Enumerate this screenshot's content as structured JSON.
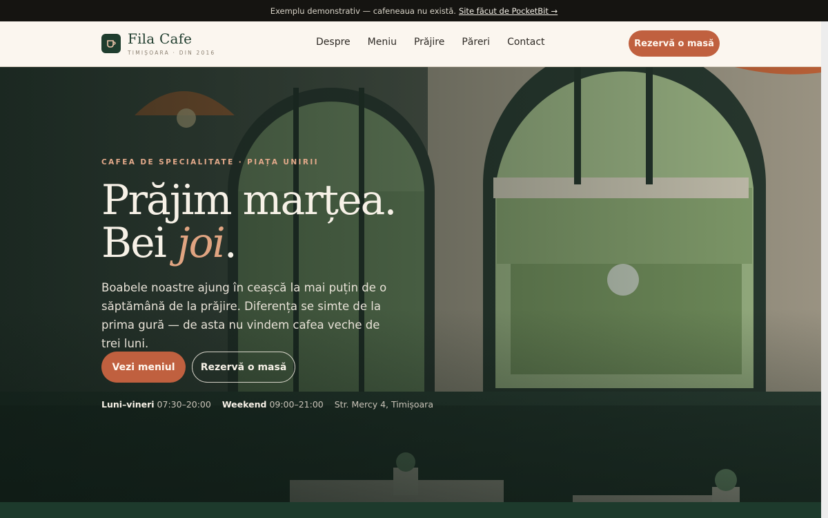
{
  "banner": {
    "text": "Exemplu demonstrativ — cafeneaua nu există.",
    "link": "Site făcut de PocketBit →"
  },
  "brand": {
    "name": "Fila Cafe",
    "subtitle": "TIMIȘOARA · DIN 2016",
    "icon": "cup-icon"
  },
  "nav": {
    "items": [
      "Despre",
      "Meniu",
      "Prăjire",
      "Păreri",
      "Contact"
    ],
    "cta": "Rezervă o masă"
  },
  "hero": {
    "eyebrow": "CAFEA DE SPECIALITATE · PIAȚA UNIRII",
    "headline_line1": "Prăjim marțea.",
    "headline_line2_prefix": "Bei ",
    "headline_line2_accent": "joi",
    "headline_line2_suffix": ".",
    "lead": "Boabele noastre ajung în ceașcă la mai puțin de o săptămână de la prăjire. Diferența se simte de la prima gură — de asta nu vindem cafea veche de trei luni.",
    "primary_button": "Vezi meniul",
    "secondary_button": "Rezervă o masă",
    "hours": [
      {
        "label": "Luni–vineri",
        "value": "07:30–20:00"
      },
      {
        "label": "Weekend",
        "value": "09:00–21:00"
      }
    ],
    "address": "Str. Mercy 4, Timișoara"
  },
  "colors": {
    "accent": "#c0603f",
    "brand_green": "#1f3d2e",
    "header_bg": "#fbf6ef"
  }
}
